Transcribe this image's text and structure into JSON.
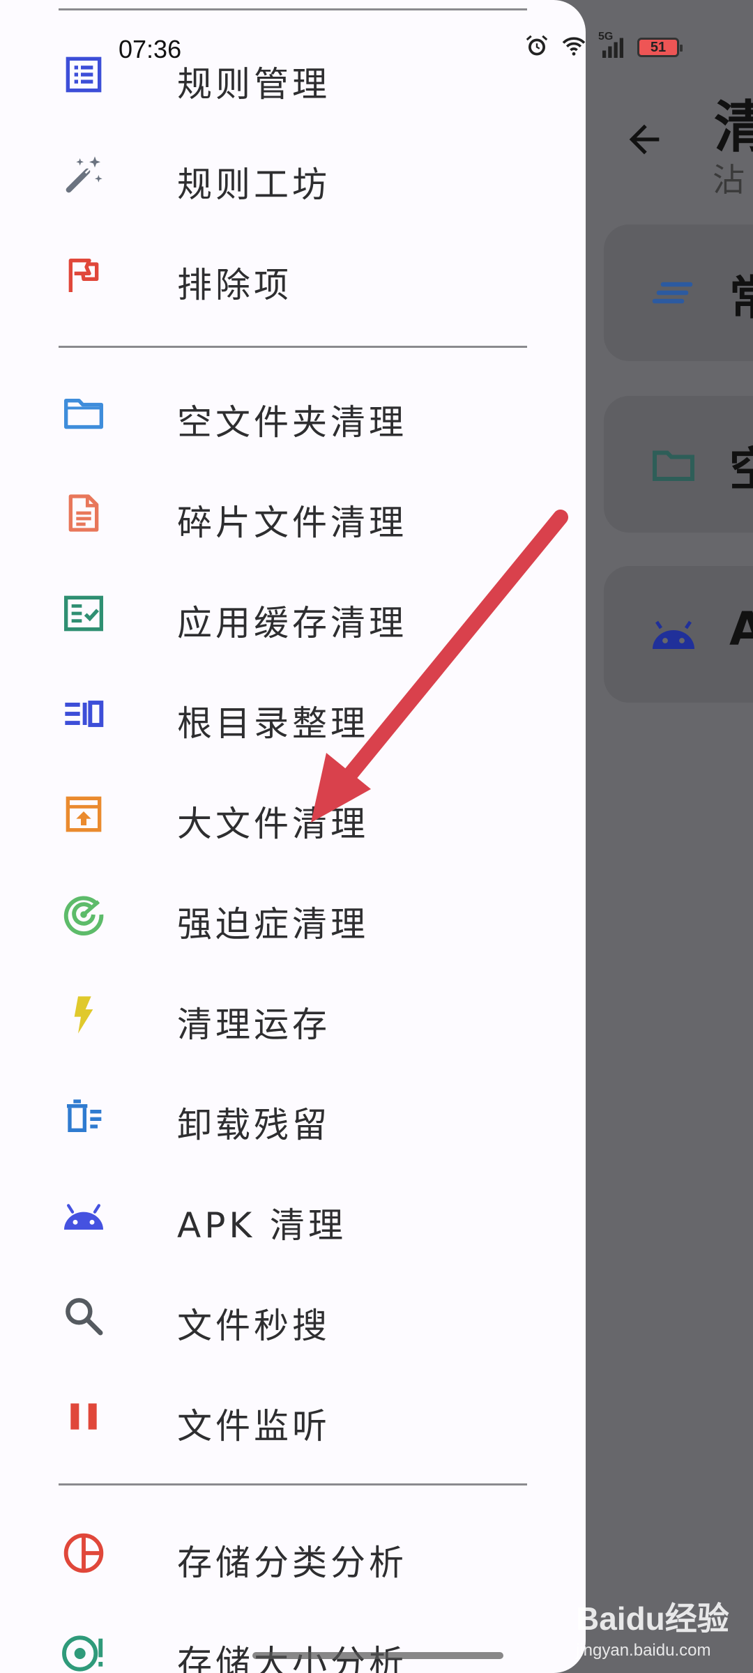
{
  "status_bar": {
    "time": "07:36",
    "network": "5G",
    "battery": "51"
  },
  "drawer": {
    "groups": [
      {
        "items": [
          {
            "name": "menu-item-rule-management",
            "label": "规则管理",
            "icon": "list-icon",
            "color": "#3d4ed8"
          },
          {
            "name": "menu-item-rule-workshop",
            "label": "规则工坊",
            "icon": "magic-wand-icon",
            "color": "#6b7380"
          },
          {
            "name": "menu-item-exclusions",
            "label": "排除项",
            "icon": "flag-icon",
            "color": "#e0473a"
          }
        ]
      },
      {
        "items": [
          {
            "name": "menu-item-empty-folder-clean",
            "label": "空文件夹清理",
            "icon": "folder-icon",
            "color": "#3f8ddb"
          },
          {
            "name": "menu-item-fragment-file-clean",
            "label": "碎片文件清理",
            "icon": "document-icon",
            "color": "#e8775a"
          },
          {
            "name": "menu-item-app-cache-clean",
            "label": "应用缓存清理",
            "icon": "checklist-icon",
            "color": "#2f8f72"
          },
          {
            "name": "menu-item-root-dir-organize",
            "label": "根目录整理",
            "icon": "root-dir-icon",
            "color": "#3d4ed8"
          },
          {
            "name": "menu-item-large-file-clean",
            "label": "大文件清理",
            "icon": "archive-box-icon",
            "color": "#ea8a2e"
          },
          {
            "name": "menu-item-ocd-clean",
            "label": "强迫症清理",
            "icon": "radar-icon",
            "color": "#5dbb6a"
          },
          {
            "name": "menu-item-memory-clean",
            "label": "清理运存",
            "icon": "lightning-icon",
            "color": "#e0c92c"
          },
          {
            "name": "menu-item-uninstall-residue",
            "label": "卸载残留",
            "icon": "trash-list-icon",
            "color": "#2f7bd0"
          },
          {
            "name": "menu-item-apk-clean",
            "label": "APK 清理",
            "icon": "android-icon",
            "color": "#4552e0"
          },
          {
            "name": "menu-item-file-search",
            "label": "文件秒搜",
            "icon": "search-icon",
            "color": "#555a60"
          },
          {
            "name": "menu-item-file-monitor",
            "label": "文件监听",
            "icon": "pause-icon",
            "color": "#e0473a"
          }
        ]
      },
      {
        "items": [
          {
            "name": "menu-item-storage-category-analysis",
            "label": "存储分类分析",
            "icon": "pie-chart-icon",
            "color": "#e0473a"
          },
          {
            "name": "menu-item-storage-size-analysis",
            "label": "存储大小分析",
            "icon": "target-icon",
            "color": "#2f9a7a"
          }
        ]
      }
    ]
  },
  "background_screen": {
    "back_icon": "arrow-left-icon",
    "title": "清",
    "subtitle": "沾",
    "cards": [
      {
        "label": "常",
        "icon": "lines-icon",
        "color": "#2c5aa0"
      },
      {
        "label": "空",
        "icon": "folder-icon",
        "color": "#2e5e58"
      },
      {
        "label": "A",
        "icon": "android-icon",
        "color": "#20309a"
      }
    ]
  },
  "annotation": {
    "color": "#d9414c"
  },
  "watermark": {
    "main": "Baidu经验",
    "sub": "jingyan.baidu.com"
  }
}
